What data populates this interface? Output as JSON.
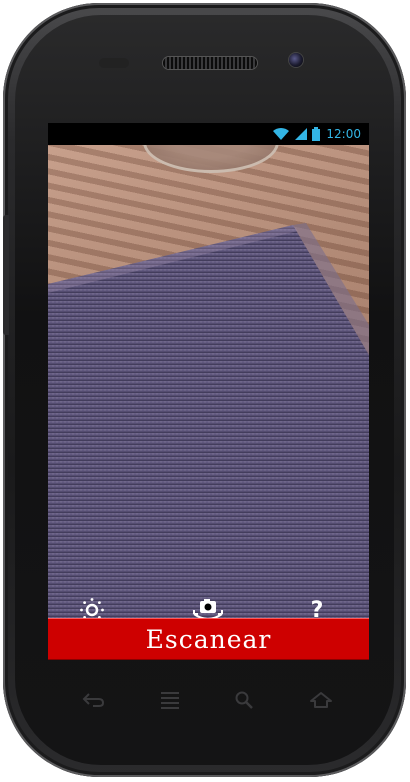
{
  "status_bar": {
    "time": "12:00",
    "icons": [
      "wifi-icon",
      "signal-icon",
      "battery-icon"
    ],
    "accent_color": "#33b5e5"
  },
  "camera_actions": [
    {
      "name": "settings-icon",
      "label": ""
    },
    {
      "name": "switch-camera-icon",
      "label": ""
    },
    {
      "name": "help-icon",
      "label": "?"
    }
  ],
  "scan_button": {
    "label": "Escanear",
    "color": "#ce0000"
  },
  "softkeys": [
    "back-icon",
    "menu-icon",
    "search-icon",
    "home-icon"
  ]
}
